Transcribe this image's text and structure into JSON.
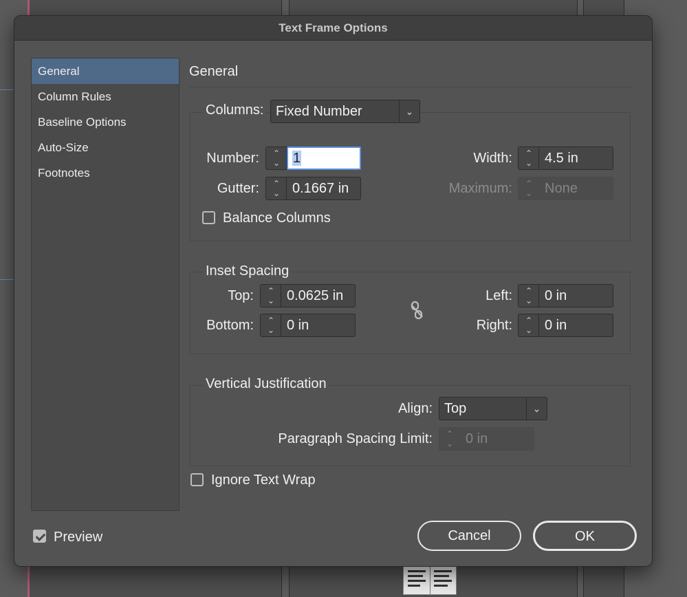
{
  "dialog": {
    "title": "Text Frame Options"
  },
  "sidebar": {
    "items": [
      {
        "label": "General"
      },
      {
        "label": "Column Rules"
      },
      {
        "label": "Baseline Options"
      },
      {
        "label": "Auto-Size"
      },
      {
        "label": "Footnotes"
      }
    ],
    "selected": "General"
  },
  "section": {
    "title": "General"
  },
  "columns": {
    "label": "Columns:",
    "type_value": "Fixed Number",
    "number_label": "Number:",
    "number_value": "1",
    "gutter_label": "Gutter:",
    "gutter_value": "0.1667 in",
    "width_label": "Width:",
    "width_value": "4.5 in",
    "maximum_label": "Maximum:",
    "maximum_value": "None",
    "balance_label": "Balance Columns",
    "balance_checked": false
  },
  "inset": {
    "title": "Inset Spacing",
    "top_label": "Top:",
    "top_value": "0.0625 in",
    "bottom_label": "Bottom:",
    "bottom_value": "0 in",
    "left_label": "Left:",
    "left_value": "0 in",
    "right_label": "Right:",
    "right_value": "0 in",
    "link_icon": "broken-chain-icon"
  },
  "vertical": {
    "title": "Vertical Justification",
    "align_label": "Align:",
    "align_value": "Top",
    "spacing_label": "Paragraph Spacing Limit:",
    "spacing_value": "0 in"
  },
  "ignore_wrap": {
    "label": "Ignore Text Wrap",
    "checked": false
  },
  "preview": {
    "label": "Preview",
    "checked": true
  },
  "buttons": {
    "cancel": "Cancel",
    "ok": "OK"
  }
}
